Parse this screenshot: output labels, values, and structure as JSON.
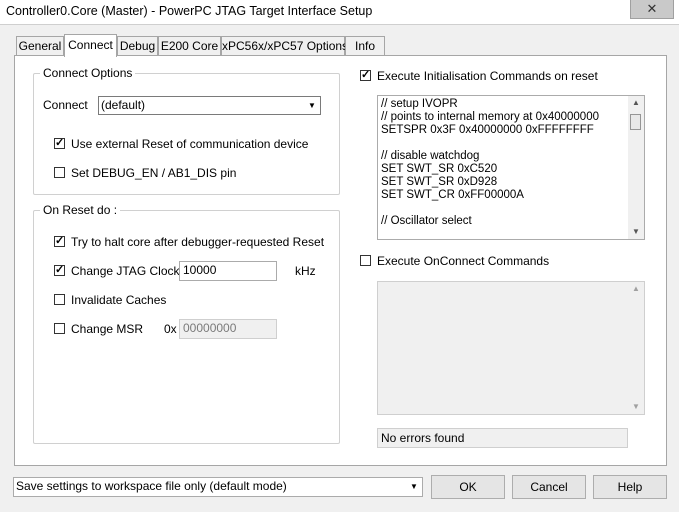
{
  "window": {
    "title": "Controller0.Core (Master) - PowerPC JTAG Target Interface Setup",
    "close_label": "✕"
  },
  "tabs": [
    {
      "label": "General"
    },
    {
      "label": "Connect"
    },
    {
      "label": "Debug"
    },
    {
      "label": "E200 Core"
    },
    {
      "label": "xPC56x/xPC57 Options"
    },
    {
      "label": "Info"
    }
  ],
  "connect_options": {
    "legend": "Connect Options",
    "connect_label": "Connect",
    "connect_value": "(default)",
    "use_external_reset": {
      "label": "Use external Reset of communication device",
      "checked": true,
      "mark": "✓"
    },
    "set_debug_en": {
      "label": "Set DEBUG_EN / AB1_DIS pin",
      "checked": false,
      "mark": ""
    }
  },
  "on_reset": {
    "legend": "On Reset do :",
    "halt_core": {
      "label": "Try to halt core after debugger-requested Reset",
      "checked": true,
      "mark": "✓"
    },
    "change_jtag_clock": {
      "label": "Change JTAG Clock :",
      "checked": true,
      "mark": "✓",
      "value": "10000",
      "unit": "kHz"
    },
    "invalidate_caches": {
      "label": "Invalidate Caches",
      "checked": false,
      "mark": ""
    },
    "change_msr": {
      "label": "Change MSR",
      "checked": false,
      "mark": "",
      "prefix": "0x",
      "value": "00000000"
    }
  },
  "init_commands": {
    "label": "Execute Initialisation Commands on reset",
    "checked": true,
    "mark": "✓",
    "lines": [
      "// setup IVOPR",
      "// points to internal memory at 0x40000000",
      "SETSPR 0x3F 0x40000000 0xFFFFFFFF",
      "",
      "// disable watchdog",
      "SET SWT_SR 0xC520",
      "SET SWT_SR 0xD928",
      "SET SWT_CR 0xFF00000A",
      "",
      "// Oscillator select"
    ]
  },
  "onconnect_commands": {
    "label": "Execute OnConnect Commands",
    "checked": false,
    "mark": ""
  },
  "status": {
    "text": "No errors found"
  },
  "footer": {
    "save_mode": "Save settings to workspace file only (default mode)",
    "ok_label": "OK",
    "cancel_label": "Cancel",
    "help_label": "Help"
  },
  "icons": {
    "scroll_up": "▲",
    "scroll_down": "▼",
    "dropdown": "▼"
  }
}
